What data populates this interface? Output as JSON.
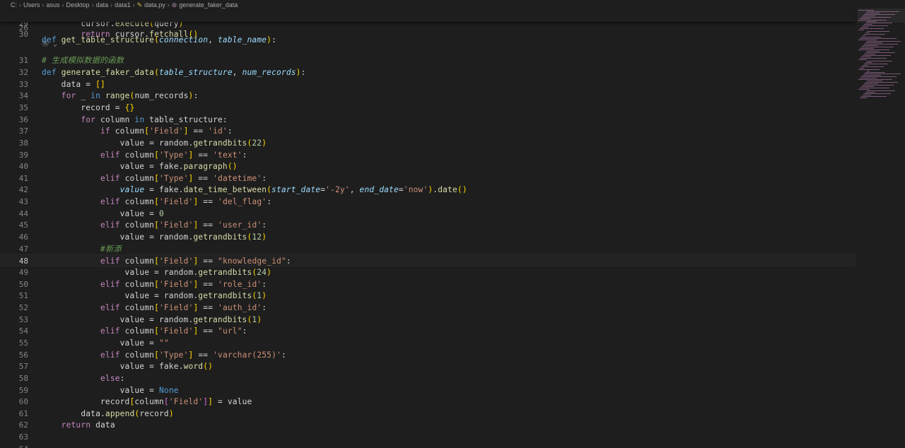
{
  "breadcrumb": {
    "items": [
      "C:",
      "Users",
      "asus",
      "Desktop",
      "data",
      "data1"
    ],
    "file": "data.py",
    "symbol": "generate_faker_data"
  },
  "sticky_line": {
    "number": "26",
    "text": "def get_table_structure(connection, table_name):"
  },
  "lines": [
    {
      "n": "29",
      "text": "        cursor.execute(query)"
    },
    {
      "n": "30",
      "text": "        return cursor.fetchall()"
    },
    {
      "n": "31",
      "text": "# 生成模拟数据的函数"
    },
    {
      "n": "32",
      "text": "def generate_faker_data(table_structure, num_records):"
    },
    {
      "n": "33",
      "text": "    data = []"
    },
    {
      "n": "34",
      "text": "    for _ in range(num_records):"
    },
    {
      "n": "35",
      "text": "        record = {}"
    },
    {
      "n": "36",
      "text": "        for column in table_structure:"
    },
    {
      "n": "37",
      "text": "            if column['Field'] == 'id':"
    },
    {
      "n": "38",
      "text": "                value = random.getrandbits(22)"
    },
    {
      "n": "39",
      "text": "            elif column['Type'] == 'text':"
    },
    {
      "n": "40",
      "text": "                value = fake.paragraph()"
    },
    {
      "n": "41",
      "text": "            elif column['Type'] == 'datetime':"
    },
    {
      "n": "42",
      "text": "                value = fake.date_time_between(start_date='-2y', end_date='now').date()"
    },
    {
      "n": "43",
      "text": "            elif column['Field'] == 'del_flag':"
    },
    {
      "n": "44",
      "text": "                value = 0"
    },
    {
      "n": "45",
      "text": "            elif column['Field'] == 'user_id':"
    },
    {
      "n": "46",
      "text": "                value = random.getrandbits(12)"
    },
    {
      "n": "47",
      "text": "            #新添"
    },
    {
      "n": "48",
      "text": "            elif column['Field'] == \"knowledge_id\":"
    },
    {
      "n": "49",
      "text": "                 value = random.getrandbits(24)"
    },
    {
      "n": "50",
      "text": "            elif column['Field'] == 'role_id':"
    },
    {
      "n": "51",
      "text": "                 value = random.getrandbits(1)"
    },
    {
      "n": "52",
      "text": "            elif column['Field'] == 'auth_id':"
    },
    {
      "n": "53",
      "text": "                value = random.getrandbits(1)"
    },
    {
      "n": "54",
      "text": "            elif column['Field'] == \"url\":"
    },
    {
      "n": "55",
      "text": "                value = \"\""
    },
    {
      "n": "56",
      "text": "            elif column['Type'] == 'varchar(255)':"
    },
    {
      "n": "57",
      "text": "                value = fake.word()"
    },
    {
      "n": "58",
      "text": "            else:"
    },
    {
      "n": "59",
      "text": "                value = None"
    },
    {
      "n": "60",
      "text": "            record[column['Field']] = value"
    },
    {
      "n": "61",
      "text": "        data.append(record)"
    },
    {
      "n": "62",
      "text": "    return data"
    },
    {
      "n": "63",
      "text": ""
    },
    {
      "n": "64",
      "text": ""
    }
  ],
  "current_line": "48",
  "fold_indicator": "⑯ ⌄",
  "colors": {
    "background": "#1e1e1e",
    "keyword": "#569cd6",
    "control": "#c586c0",
    "function": "#dcdcaa",
    "string": "#ce9178",
    "number": "#b5cea8",
    "parameter": "#9cdcfe",
    "comment": "#6a9955"
  }
}
